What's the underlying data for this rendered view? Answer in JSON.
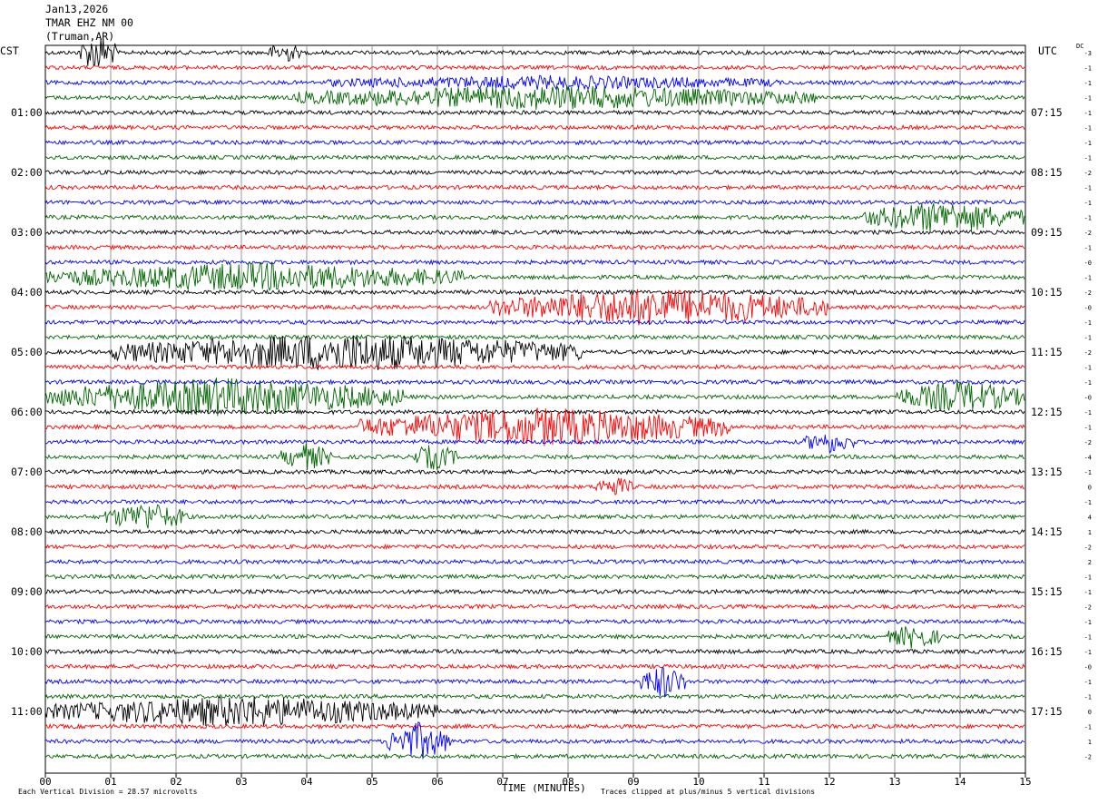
{
  "header": {
    "date": "Jan13,2026",
    "station": "TMAR EHZ NM 00",
    "location": "(Truman,AR)"
  },
  "left_corner_label": "CST",
  "right_corner_label": "UTC",
  "dc_label": "DC",
  "footer": {
    "scale_text": "Each Vertical Division =   28.57 microvolts",
    "clip_text": "Traces clipped at plus/minus 5 vertical divisions"
  },
  "colors": {
    "cycle": [
      "#000000",
      "#ff0000",
      "#0000ff",
      "#006600"
    ],
    "grid": "#808080",
    "background": "#ffffff"
  },
  "chart_data": {
    "type": "line",
    "title": "TMAR EHZ NM 00",
    "xlabel": "TIME (MINUTES)",
    "x_range": [
      0,
      15
    ],
    "x_ticks": [
      "00",
      "01",
      "02",
      "03",
      "04",
      "05",
      "06",
      "07",
      "08",
      "09",
      "10",
      "11",
      "12",
      "13",
      "14",
      "15"
    ],
    "trace_count": 48,
    "trace_minutes": 15,
    "left_time_labels": [
      "01:00",
      "02:00",
      "03:00",
      "04:00",
      "05:00",
      "06:00",
      "07:00",
      "08:00",
      "09:00",
      "10:00",
      "11:00"
    ],
    "right_time_labels": [
      "07:15",
      "08:15",
      "09:15",
      "10:15",
      "11:15",
      "12:15",
      "13:15",
      "14:15",
      "15:15",
      "16:15",
      "17:15"
    ],
    "dc_offsets": [
      "-3",
      "-1",
      "-1",
      "-1",
      "-1",
      "-1",
      "-1",
      "-1",
      "-2",
      "-1",
      "-1",
      "-1",
      "-2",
      "-1",
      "-0",
      "-1",
      "-2",
      "-0",
      "-1",
      "-1",
      "-2",
      "-1",
      "-1",
      "-0",
      "-1",
      "-1",
      "-2",
      "-4",
      "-1",
      "0",
      "-1",
      "4",
      "1",
      "-2",
      "2",
      "-1",
      "-1",
      "-2",
      "-1",
      "-1",
      "-1",
      "-0",
      "-1",
      "-1",
      "0",
      "-1",
      "1",
      "-2"
    ],
    "events": [
      {
        "trace": 0,
        "start_min": 0.5,
        "end_min": 1.1,
        "amplitude": 3.0
      },
      {
        "trace": 0,
        "start_min": 3.4,
        "end_min": 3.9,
        "amplitude": 1.6
      },
      {
        "trace": 2,
        "start_min": 4.3,
        "end_min": 11.2,
        "amplitude": 0.9
      },
      {
        "trace": 3,
        "start_min": 3.8,
        "end_min": 11.8,
        "amplitude": 1.8
      },
      {
        "trace": 11,
        "start_min": 12.5,
        "end_min": 15.0,
        "amplitude": 2.5
      },
      {
        "trace": 15,
        "start_min": 0.0,
        "end_min": 6.4,
        "amplitude": 2.2
      },
      {
        "trace": 17,
        "start_min": 6.8,
        "end_min": 12.0,
        "amplitude": 3.0
      },
      {
        "trace": 20,
        "start_min": 1.0,
        "end_min": 8.2,
        "amplitude": 3.0
      },
      {
        "trace": 23,
        "start_min": 0.0,
        "end_min": 5.5,
        "amplitude": 3.0
      },
      {
        "trace": 23,
        "start_min": 13.0,
        "end_min": 15.0,
        "amplitude": 2.5
      },
      {
        "trace": 25,
        "start_min": 4.8,
        "end_min": 10.5,
        "amplitude": 3.0
      },
      {
        "trace": 26,
        "start_min": 11.6,
        "end_min": 12.4,
        "amplitude": 1.6
      },
      {
        "trace": 27,
        "start_min": 3.6,
        "end_min": 4.4,
        "amplitude": 2.0
      },
      {
        "trace": 27,
        "start_min": 5.6,
        "end_min": 6.3,
        "amplitude": 2.0
      },
      {
        "trace": 29,
        "start_min": 8.4,
        "end_min": 9.0,
        "amplitude": 1.5
      },
      {
        "trace": 31,
        "start_min": 0.9,
        "end_min": 2.2,
        "amplitude": 2.2
      },
      {
        "trace": 42,
        "start_min": 9.1,
        "end_min": 9.8,
        "amplitude": 2.6
      },
      {
        "trace": 44,
        "start_min": 0.0,
        "end_min": 6.0,
        "amplitude": 2.4
      },
      {
        "trace": 46,
        "start_min": 5.2,
        "end_min": 6.2,
        "amplitude": 3.0
      },
      {
        "trace": 39,
        "start_min": 12.9,
        "end_min": 13.7,
        "amplitude": 1.8
      }
    ]
  }
}
